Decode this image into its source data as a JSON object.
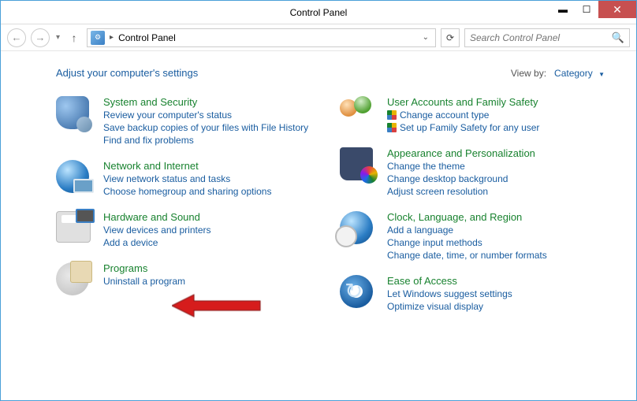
{
  "window": {
    "title": "Control Panel"
  },
  "address": {
    "location": "Control Panel"
  },
  "search": {
    "placeholder": "Search Control Panel"
  },
  "heading": "Adjust your computer's settings",
  "viewby": {
    "label": "View by:",
    "value": "Category"
  },
  "left": [
    {
      "title": "System and Security",
      "links": [
        {
          "text": "Review your computer's status",
          "shield": false
        },
        {
          "text": "Save backup copies of your files with File History",
          "shield": false
        },
        {
          "text": "Find and fix problems",
          "shield": false
        }
      ]
    },
    {
      "title": "Network and Internet",
      "links": [
        {
          "text": "View network status and tasks",
          "shield": false
        },
        {
          "text": "Choose homegroup and sharing options",
          "shield": false
        }
      ]
    },
    {
      "title": "Hardware and Sound",
      "links": [
        {
          "text": "View devices and printers",
          "shield": false
        },
        {
          "text": "Add a device",
          "shield": false
        }
      ]
    },
    {
      "title": "Programs",
      "links": [
        {
          "text": "Uninstall a program",
          "shield": false
        }
      ]
    }
  ],
  "right": [
    {
      "title": "User Accounts and Family Safety",
      "links": [
        {
          "text": "Change account type",
          "shield": true
        },
        {
          "text": "Set up Family Safety for any user",
          "shield": true
        }
      ]
    },
    {
      "title": "Appearance and Personalization",
      "links": [
        {
          "text": "Change the theme",
          "shield": false
        },
        {
          "text": "Change desktop background",
          "shield": false
        },
        {
          "text": "Adjust screen resolution",
          "shield": false
        }
      ]
    },
    {
      "title": "Clock, Language, and Region",
      "links": [
        {
          "text": "Add a language",
          "shield": false
        },
        {
          "text": "Change input methods",
          "shield": false
        },
        {
          "text": "Change date, time, or number formats",
          "shield": false
        }
      ]
    },
    {
      "title": "Ease of Access",
      "links": [
        {
          "text": "Let Windows suggest settings",
          "shield": false
        },
        {
          "text": "Optimize visual display",
          "shield": false
        }
      ]
    }
  ],
  "annotation": {
    "type": "arrow",
    "target": "Programs",
    "color": "#d61f1f"
  }
}
